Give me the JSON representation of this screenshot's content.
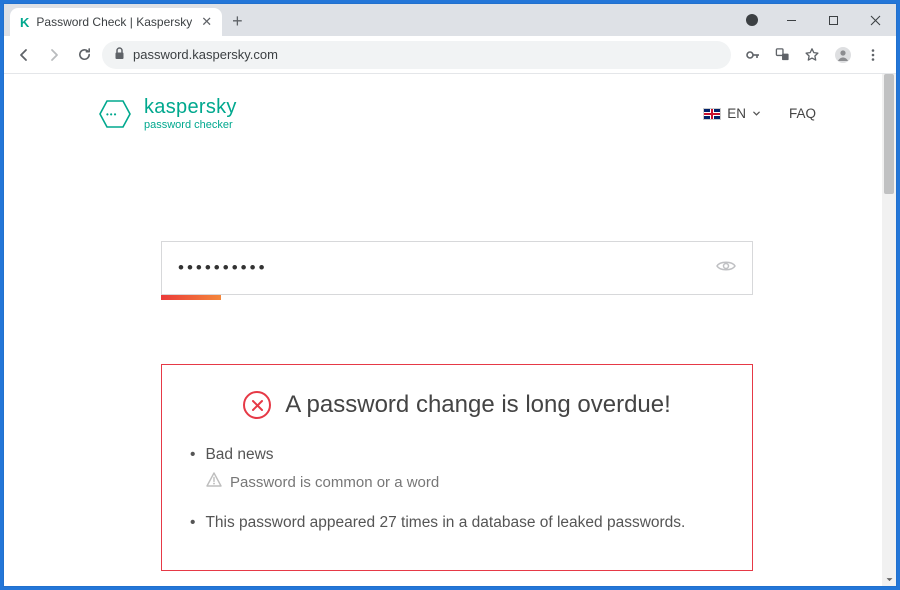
{
  "browser": {
    "tab_title": "Password Check | Kaspersky",
    "url": "password.kaspersky.com"
  },
  "header": {
    "brand_name": "kaspersky",
    "brand_sub": "password checker",
    "lang_label": "EN",
    "faq_label": "FAQ"
  },
  "password_field": {
    "masked_value": "••••••••••"
  },
  "result": {
    "title": "A password change is long overdue!",
    "items": [
      "Bad news",
      "This password appeared 27 times in a database of leaked passwords."
    ],
    "detail_line": "Password is common or a word"
  }
}
